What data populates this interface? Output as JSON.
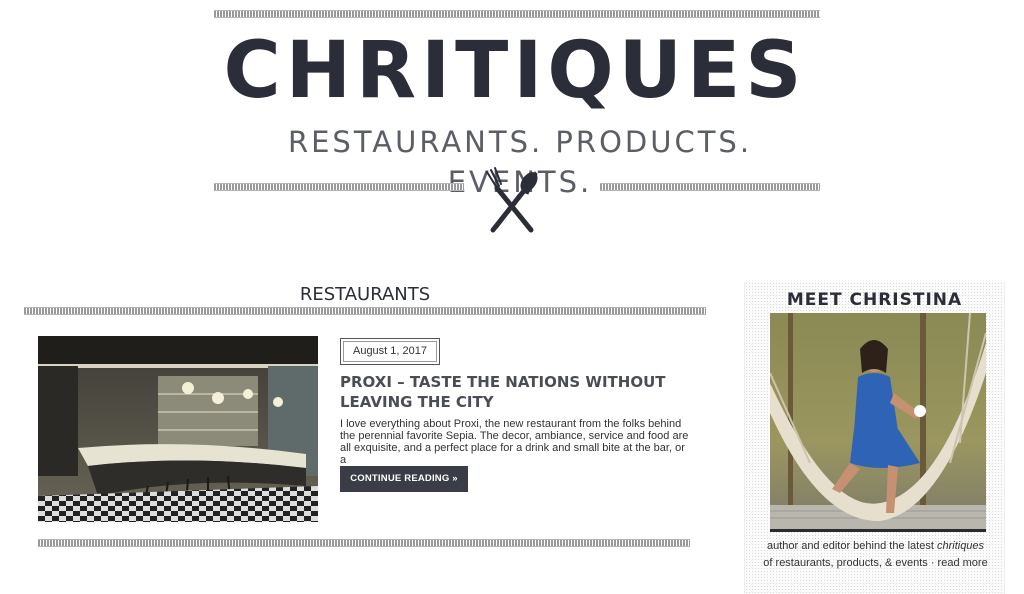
{
  "header": {
    "logo_title": "CHRITIQUES",
    "logo_tagline": "RESTAURANTS. PRODUCTS. EVENTS.",
    "logo_icon": "fork-knife-spoon-crossed-icon"
  },
  "main": {
    "section_title": "RESTAURANTS",
    "post": {
      "date": "August 1, 2017",
      "title": "PROXI – TASTE THE NATIONS WITHOUT LEAVING THE CITY",
      "excerpt": "I love everything about Proxi, the new restaurant from the folks behind the perennial favorite Sepia.  The decor, ambiance, service and food are all exquisite, and a perfect place for a drink and small bite at the bar, or a",
      "continue_label": "CONTINUE READING »"
    }
  },
  "sidebar": {
    "title": "MEET CHRISTINA",
    "bio_prefix": "author and editor behind the latest ",
    "bio_italic": "chritiques",
    "bio_suffix": " of restaurants, products, & events · ",
    "read_more": "read more"
  },
  "colors": {
    "brand_dark": "#2b2e38",
    "button_bg": "#3a3d45",
    "rule_gray": "#9a9a9a"
  }
}
